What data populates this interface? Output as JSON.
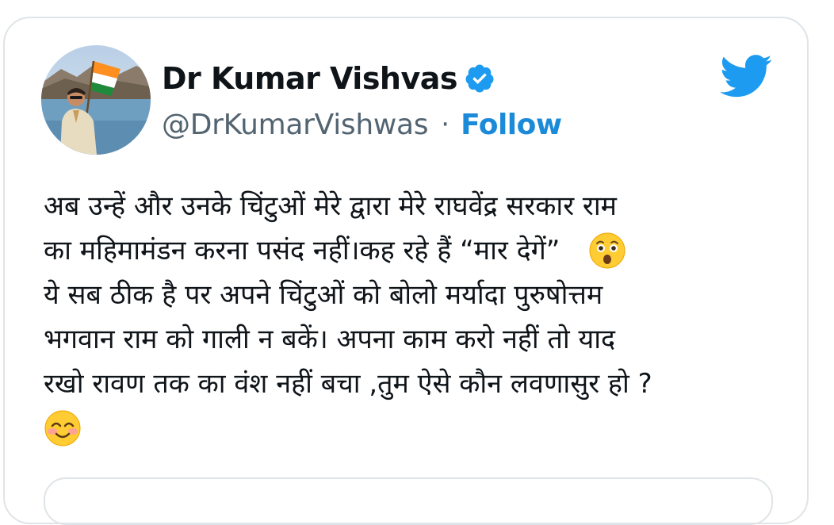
{
  "tweet": {
    "author": {
      "display_name": "Dr Kumar Vishvas",
      "handle": "@DrKumarVishwas",
      "verified": true,
      "avatar": "profile-photo"
    },
    "separator": "·",
    "follow_label": "Follow",
    "brand_icon": "twitter-bird-icon",
    "colors": {
      "brand": "#1d9bf0",
      "follow": "#1b8ad8",
      "text": "#0f1419",
      "muted": "#536471",
      "border": "#dfe4e8"
    },
    "body_lines": [
      "अब उन्हें और उनके चिंटुओं मेरे द्वारा मेरे राघवेंद्र सरकार राम",
      "का महिमामंडन करना पसंद नहीं।कह रहे हैं  “मार देगें”",
      "ये सब ठीक है पर अपने चिंटुओं को बोलो मर्यादा पुरुषोत्तम",
      "भगवान राम को गाली न बकें। अपना काम करो नहीं तो याद",
      "रखो रावण तक का वंश नहीं बचा ,तुम ऐसे कौन लवणासुर हो ?"
    ],
    "emojis": [
      "astonished-face-emoji",
      "smiling-face-with-smiling-eyes-emoji"
    ]
  }
}
